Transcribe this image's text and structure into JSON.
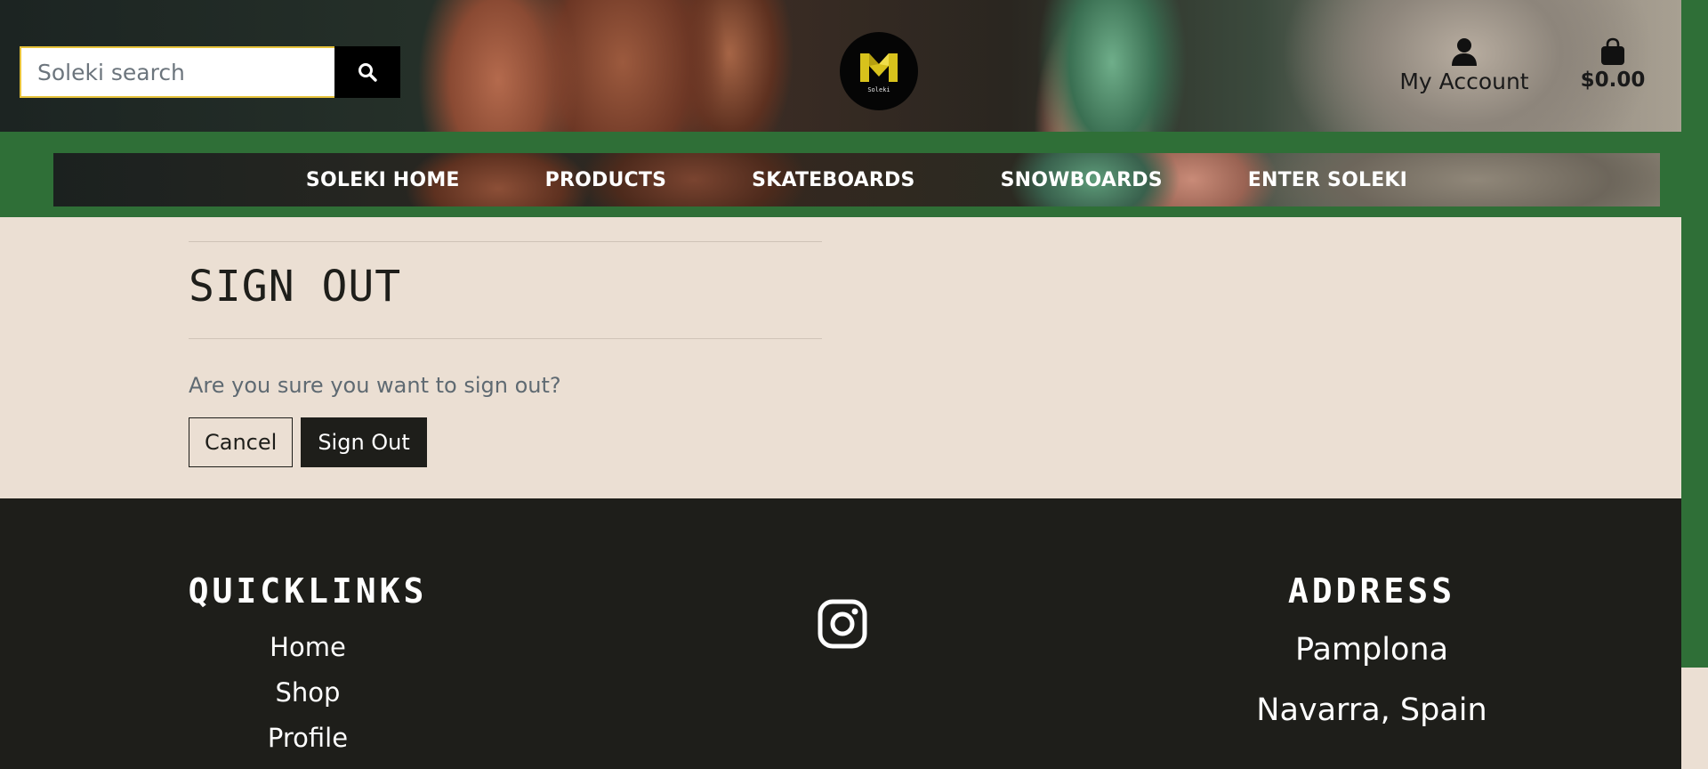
{
  "header": {
    "search": {
      "placeholder": "Soleki search",
      "value": ""
    },
    "logo_text": "Soleki",
    "account_label": "My Account",
    "bag_total": "$0.00"
  },
  "nav": {
    "items": [
      {
        "label": "SOLEKI HOME"
      },
      {
        "label": "PRODUCTS"
      },
      {
        "label": "SKATEBOARDS"
      },
      {
        "label": "SNOWBOARDS"
      },
      {
        "label": "ENTER SOLEKI"
      }
    ]
  },
  "main": {
    "title": "SIGN OUT",
    "confirm_text": "Are you sure you want to sign out?",
    "cancel_label": "Cancel",
    "signout_label": "Sign Out"
  },
  "footer": {
    "quicklinks_heading": "QUICKLINKS",
    "links": [
      "Home",
      "Shop",
      "Profile"
    ],
    "address_heading": "ADDRESS",
    "address_lines": [
      "Pamplona",
      "Navarra, Spain"
    ]
  },
  "colors": {
    "brand_green": "#2f6f37",
    "page_bg": "#ebdfd3",
    "dark": "#1e1e1a",
    "search_border": "#e6c23a",
    "logo_yellow": "#d8c21c"
  },
  "icons": [
    "search-icon",
    "user-icon",
    "shopping-bag-icon",
    "instagram-icon"
  ]
}
